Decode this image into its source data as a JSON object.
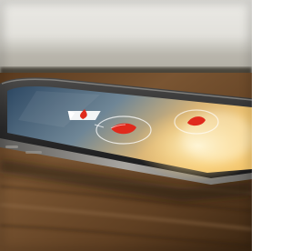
{
  "scene": {
    "description_visible": false,
    "colors": {
      "wall_top": "#d9d8d2",
      "wall_bottom": "#8d8a80",
      "shelf_edge": "#3a352d",
      "table_dark": "#3c2714",
      "table_mid": "#6b4a2a",
      "table_light": "#8a6744",
      "phone_body": "#2b2b2c",
      "phone_edge": "#8a8886",
      "screen_left": "#2f4d6b",
      "screen_right": "#e6b86a",
      "glow": "#fff2c2",
      "drop_red": "#e02a1c"
    }
  },
  "phone_screen": {
    "icons": [
      {
        "name": "red-drop-badge-icon",
        "shape": "badge"
      },
      {
        "name": "red-drop-center-icon",
        "shape": "drop-in-ring"
      },
      {
        "name": "red-drop-right-icon",
        "shape": "drop-in-ring"
      }
    ]
  }
}
